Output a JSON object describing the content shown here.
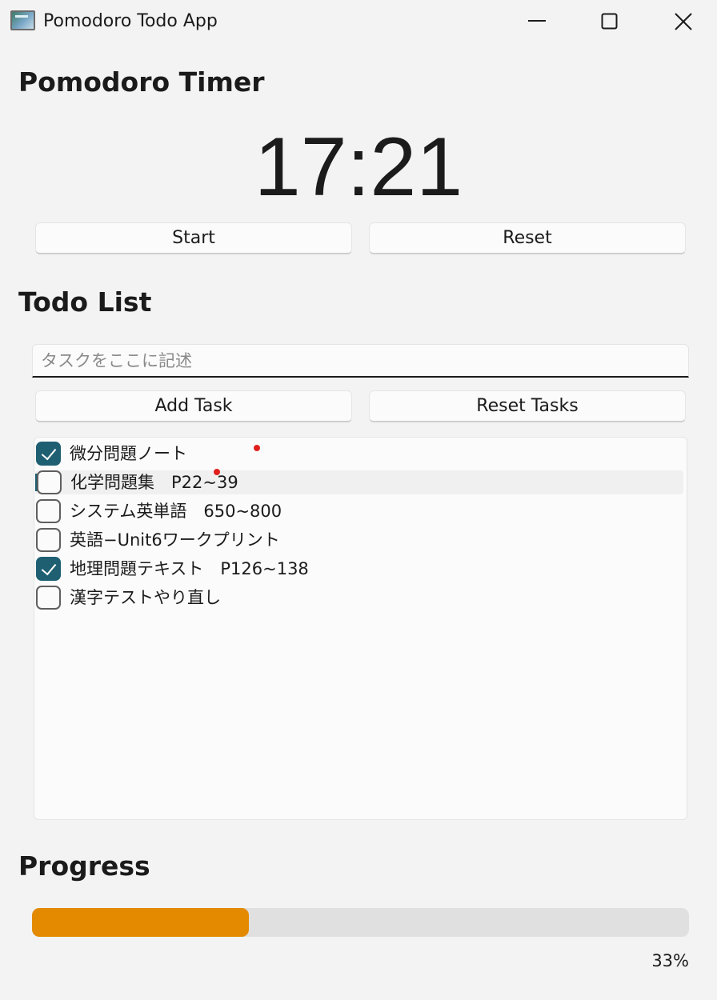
{
  "window": {
    "title": "Pomodoro Todo App"
  },
  "timer": {
    "heading": "Pomodoro Timer",
    "display": "17:21",
    "start_label": "Start",
    "reset_label": "Reset"
  },
  "todo": {
    "heading": "Todo List",
    "input_placeholder": "タスクをここに記述",
    "input_value": "",
    "add_label": "Add Task",
    "reset_tasks_label": "Reset Tasks",
    "tasks": [
      {
        "label": "微分問題ノート",
        "checked": true
      },
      {
        "label": "化学問題集　P22~39",
        "checked": false
      },
      {
        "label": "システム英単語　650~800",
        "checked": false
      },
      {
        "label": "英語−Unit6ワークプリント",
        "checked": false
      },
      {
        "label": "地理問題テキスト　P126~138",
        "checked": true
      },
      {
        "label": "漢字テストやり直し",
        "checked": false
      }
    ]
  },
  "progress": {
    "heading": "Progress",
    "value": 0.33,
    "percent_label": "33%"
  },
  "colors": {
    "accent": "#1f5f72",
    "progress_fill": "#e38a00",
    "progress_track": "#e0e0e0",
    "marker_dot": "#e0201e"
  }
}
